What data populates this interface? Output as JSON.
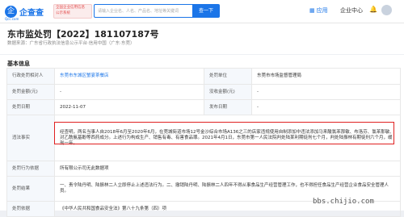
{
  "header": {
    "logo_mark": "企",
    "logo_text": "企查查",
    "logo_sub": "Qcc.com",
    "badge": [
      "全国企业信用信息",
      "公示系统",
      "备案企业信用平台"
    ],
    "search_placeholder": "请输入企业名、人名、产品名、地址等关键词",
    "search_button": "查一下",
    "app_link": "应用",
    "ent_link": "企业中心"
  },
  "page": {
    "title": "东市监处罚【2022】181107187号",
    "source": "数据来源：广东省行政执法信息公示平台·信用中国（广东·东莞）"
  },
  "section": {
    "title": "基本信息"
  },
  "details": {
    "party_label": "行政处罚相对人",
    "party_value": "东莞市东城区蟹宴茶餐店",
    "authority_label": "处罚单位",
    "authority_value": "东莞市市场监督管理局",
    "amount_label": "处罚金额(元)",
    "amount_value": "-",
    "illegal_income_label": "没收金额(元)",
    "illegal_income_value": "-",
    "date_label": "处罚日期",
    "date_value": "2022-11-07",
    "publish_label": "发布日期",
    "publish_value": "-",
    "facts_label": "违法事实",
    "facts_value": "经查明，两名当事人自2018年6月至2020年6月，在莞城街道市场12号金沙综合市场A136之三的店家违规使用自制添加中违法添加马来酸氯苯那敏、布洛芬、氯苯那敏、对乙酰氨基酚等西药成分。上述行为构成生产、销售有毒、有害食品罪。2021年4月1日，东莞市第一人民法院判处陆某利期徒刑七个月，判处陆振林有期徒刑六个月，缓刑一年。",
    "basis_label": "处罚行为依据",
    "basis_value": "所有限公示司无此数据项",
    "result_label": "处罚结果",
    "result_value": "一、责令陆丹明、陆振林二人立即停止上述违法行为。二、撤销陆丹明、陆振林二人四年不得从事食品生产经营管理工作，也不得担任食品生产经营企业食品安全管理人员。",
    "law_label": "处罚依据",
    "law_value": "《中华人民共和国食品安全法》第八十九条第（四）项"
  },
  "watermark": "bbs.chijio.com"
}
